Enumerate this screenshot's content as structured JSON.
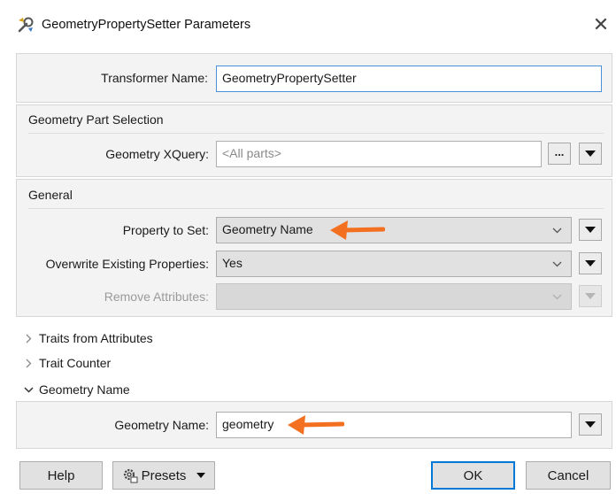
{
  "window": {
    "title": "GeometryPropertySetter Parameters",
    "close_glyph": "✕"
  },
  "transformer": {
    "name_label": "Transformer Name:",
    "name_value": "GeometryPropertySetter"
  },
  "geometry_part_selection": {
    "section_title": "Geometry Part Selection",
    "xquery_label": "Geometry XQuery:",
    "xquery_placeholder": "<All parts>",
    "browse_label": "..."
  },
  "general": {
    "section_title": "General",
    "property_to_set_label": "Property to Set:",
    "property_to_set_value": "Geometry Name",
    "overwrite_label": "Overwrite Existing Properties:",
    "overwrite_value": "Yes",
    "remove_attributes_label": "Remove Attributes:",
    "remove_attributes_value": ""
  },
  "collapsible_sections": [
    {
      "label": "Traits from Attributes",
      "expanded": false
    },
    {
      "label": "Trait Counter",
      "expanded": false
    },
    {
      "label": "Geometry Name",
      "expanded": true
    }
  ],
  "geometry_name": {
    "label": "Geometry Name:",
    "value": "geometry"
  },
  "footer": {
    "help_label": "Help",
    "presets_label": "Presets",
    "ok_label": "OK",
    "cancel_label": "Cancel"
  },
  "icons": {
    "app_icon": "fme-transformer-icon",
    "presets_icon": "gear-icon",
    "annotation_arrow": "orange-arrow-icon"
  },
  "colors": {
    "annotation_arrow": "#f37021",
    "focus_border": "#4a90d9",
    "default_button_border": "#0078d7"
  }
}
